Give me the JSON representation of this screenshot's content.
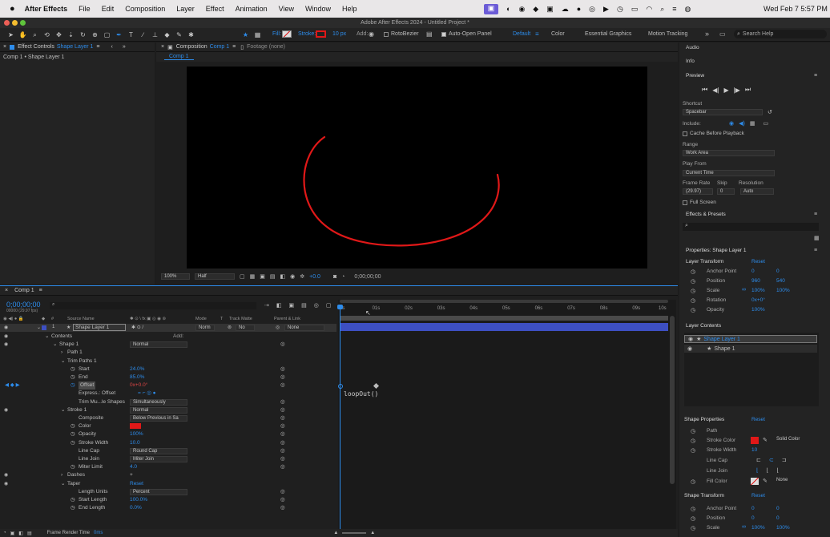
{
  "menubar": {
    "apple": "",
    "app": "After Effects",
    "items": [
      "File",
      "Edit",
      "Composition",
      "Layer",
      "Effect",
      "Animation",
      "View",
      "Window",
      "Help"
    ],
    "clock": "Wed Feb 7  5:57 PM"
  },
  "title": "Adobe After Effects 2024 - Untitled Project *",
  "toolbar": {
    "fill_label": "Fill:",
    "stroke_label": "Stroke:",
    "stroke_width": "10 px",
    "add_label": "Add:",
    "rotobezier": "RotoBezier",
    "auto_open": "Auto-Open Panel",
    "workspaces": [
      "Default",
      "Color",
      "Essential Graphics",
      "Motion Tracking"
    ],
    "search_placeholder": "Search Help"
  },
  "left_panel": {
    "tab": "Effect Controls",
    "tab_layer": "Shape Layer 1",
    "breadcrumb": "Comp 1 • Shape Layer 1"
  },
  "comp_panel": {
    "tab": "Composition",
    "tab_comp": "Comp 1",
    "footage_tab": "Footage (none)",
    "sub_tab": "Comp 1",
    "zoom": "100%",
    "resolution": "Half",
    "exposure": "+0.0",
    "timecode": "0;00;00;00"
  },
  "timeline": {
    "tab": "Comp 1",
    "timecode": "0;00;00;00",
    "fps": "00000 (29.97 fps)",
    "col_headers": {
      "source": "Source Name",
      "mode": "Mode",
      "t": "T",
      "trackmatte": "Track Matte",
      "parent": "Parent & Link"
    },
    "layer": {
      "num": "1",
      "name": "Shape Layer 1",
      "mode": "Norm",
      "matte": "No",
      "parent": "None"
    },
    "ruler": [
      "0s",
      "01s",
      "02s",
      "03s",
      "04s",
      "05s",
      "06s",
      "07s",
      "08s",
      "09s",
      "10s"
    ],
    "expression": "loopOut()",
    "frame_render": "Frame Render Time",
    "frame_render_val": "0ms",
    "rows": [
      {
        "label": "Contents",
        "indent": 0,
        "add": "Add:"
      },
      {
        "label": "Shape 1",
        "indent": 1,
        "dropdown": "Normal"
      },
      {
        "label": "Path 1",
        "indent": 2
      },
      {
        "label": "Trim Paths 1",
        "indent": 2
      },
      {
        "label": "Start",
        "indent": 3,
        "value": "24.0%"
      },
      {
        "label": "End",
        "indent": 3,
        "value": "85.0%"
      },
      {
        "label": "Offset",
        "indent": 3,
        "value": "0x+0.0°",
        "red": true
      },
      {
        "label": "Express.: Offset",
        "indent": 3
      },
      {
        "label": "Trim Mu...le Shapes",
        "indent": 3,
        "dropdown": "Simultaneously"
      },
      {
        "label": "Stroke 1",
        "indent": 2,
        "dropdown": "Normal"
      },
      {
        "label": "Composite",
        "indent": 3,
        "dropdown": "Below Previous in Sa"
      },
      {
        "label": "Color",
        "indent": 3
      },
      {
        "label": "Opacity",
        "indent": 3,
        "value": "100%"
      },
      {
        "label": "Stroke Width",
        "indent": 3,
        "value": "10.0"
      },
      {
        "label": "Line Cap",
        "indent": 3,
        "dropdown": "Round Cap"
      },
      {
        "label": "Line Join",
        "indent": 3,
        "dropdown": "Miter Join"
      },
      {
        "label": "Miter Limit",
        "indent": 3,
        "value": "4.0"
      },
      {
        "label": "Dashes",
        "indent": 2
      },
      {
        "label": "Taper",
        "indent": 2,
        "reset": "Reset"
      },
      {
        "label": "Length Units",
        "indent": 3,
        "dropdown": "Percent"
      },
      {
        "label": "Start Length",
        "indent": 3,
        "value": "100.0%"
      },
      {
        "label": "End Length",
        "indent": 3,
        "value": "0.0%"
      }
    ]
  },
  "right_panel": {
    "audio": "Audio",
    "info": "Info",
    "preview": "Preview",
    "shortcut_label": "Shortcut",
    "shortcut": "Spacebar",
    "include_label": "Include:",
    "cache": "Cache Before Playback",
    "range_label": "Range",
    "range": "Work Area",
    "play_from_label": "Play From",
    "play_from": "Current Time",
    "frame_rate_label": "Frame Rate",
    "skip_label": "Skip",
    "resolution_label": "Resolution",
    "frame_rate": "(29.97)",
    "skip": "0",
    "resolution": "Auto",
    "full_screen": "Full Screen",
    "effects_presets": "Effects & Presets",
    "properties": "Properties: Shape Layer 1",
    "layer_transform": "Layer Transform",
    "reset": "Reset",
    "transform": [
      {
        "label": "Anchor Point",
        "v1": "0",
        "v2": "0"
      },
      {
        "label": "Position",
        "v1": "960",
        "v2": "540"
      },
      {
        "label": "Scale",
        "v1": "100%",
        "v2": "100%"
      },
      {
        "label": "Rotation",
        "v1": "0x+0°",
        "v2": ""
      },
      {
        "label": "Opacity",
        "v1": "100%",
        "v2": ""
      }
    ],
    "layer_contents": "Layer Contents",
    "contents_items": [
      "Shape Layer 1",
      "Shape 1"
    ],
    "shape_properties": "Shape Properties",
    "shape_props": {
      "path": "Path",
      "stroke_color": "Stroke Color",
      "stroke_color_mode": "Solid Color",
      "stroke_width": "Stroke Width",
      "stroke_width_val": "10",
      "line_cap": "Line Cap",
      "line_join": "Line Join",
      "fill_color": "Fill Color",
      "fill_mode": "None"
    },
    "shape_transform": "Shape Transform",
    "shape_transform_rows": [
      {
        "label": "Anchor Point",
        "v1": "0",
        "v2": "0"
      },
      {
        "label": "Position",
        "v1": "0",
        "v2": "0"
      },
      {
        "label": "Scale",
        "v1": "100%",
        "v2": "100%"
      }
    ]
  },
  "colors": {
    "accent": "#2d8ceb",
    "stroke": "#e01818",
    "layer_bar": "#3d4fc2"
  }
}
